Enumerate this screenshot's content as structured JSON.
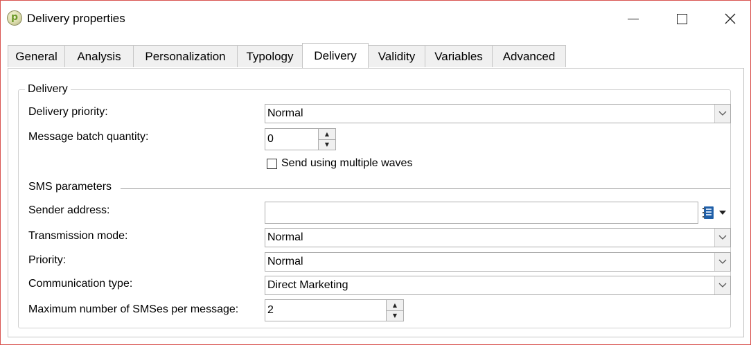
{
  "window": {
    "title": "Delivery properties"
  },
  "tabs": [
    {
      "label": "General"
    },
    {
      "label": "Analysis"
    },
    {
      "label": "Personalization"
    },
    {
      "label": "Typology"
    },
    {
      "label": "Delivery",
      "active": true
    },
    {
      "label": "Validity"
    },
    {
      "label": "Variables"
    },
    {
      "label": "Advanced"
    }
  ],
  "delivery_group": {
    "legend": "Delivery",
    "priority_label": "Delivery priority:",
    "priority_value": "Normal",
    "batch_label": "Message batch quantity:",
    "batch_value": "0",
    "waves_label": "Send using multiple waves",
    "waves_checked": false
  },
  "sms": {
    "section_title": "SMS parameters",
    "sender_label": "Sender address:",
    "sender_value": "",
    "transmission_label": "Transmission mode:",
    "transmission_value": "Normal",
    "priority_label": "Priority:",
    "priority_value": "Normal",
    "comm_type_label": "Communication type:",
    "comm_type_value": "Direct Marketing",
    "max_sms_label": "Maximum number of SMSes per message:",
    "max_sms_value": "2"
  },
  "colors": {
    "window_border": "#d9534f",
    "icon_blue": "#1f5fa8"
  },
  "icons": {
    "app": "app-logo-icon",
    "address_book": "address-book-icon"
  }
}
